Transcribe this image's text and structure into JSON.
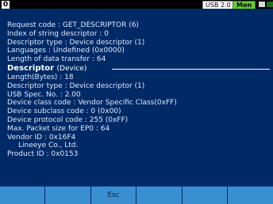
{
  "status_bar": {
    "tab_number": "0",
    "usb_badge": "USB 2.0",
    "mode_badge": "Mon"
  },
  "request": [
    {
      "label": "Request code",
      "value": "GET_DESCRIPTOR (6)"
    },
    {
      "label": "Index of string descriptor",
      "value": "0"
    },
    {
      "label": "Descriptor type",
      "value": "Device descriptor (1)"
    },
    {
      "label": "Languages",
      "value": "Undefined (0x0000)"
    },
    {
      "label": "Length of data transfer",
      "value": "64"
    }
  ],
  "descriptor": {
    "title": "Descriptor",
    "subtitle": "(Device)",
    "fields": [
      {
        "label": "Length(Bytes)",
        "value": "18"
      },
      {
        "label": "Descriptor type",
        "value": "Device descriptor (1)"
      },
      {
        "label": "USB Spec. No.",
        "value": "2.00"
      },
      {
        "label": "Device class code",
        "value": "Vendor Specific Class(0xFF)"
      },
      {
        "label": "Device subclass code",
        "value": "0 (0x00)"
      },
      {
        "label": "Device protocol code",
        "value": "255 (0xFF)"
      },
      {
        "label": "Max. Packet size for EP0",
        "value": "64"
      },
      {
        "label": "Vendor ID",
        "value": "0x16F4"
      }
    ],
    "vendor_name": "Lineeye Co., Ltd.",
    "product": {
      "label": "Product ID",
      "value": "0x0153"
    }
  },
  "function_keys": [
    "",
    "",
    "Esc",
    "",
    "",
    ""
  ],
  "colors": {
    "background": "#002a66",
    "accent": "#3a8fd0",
    "mon_badge": "#66cc33"
  }
}
